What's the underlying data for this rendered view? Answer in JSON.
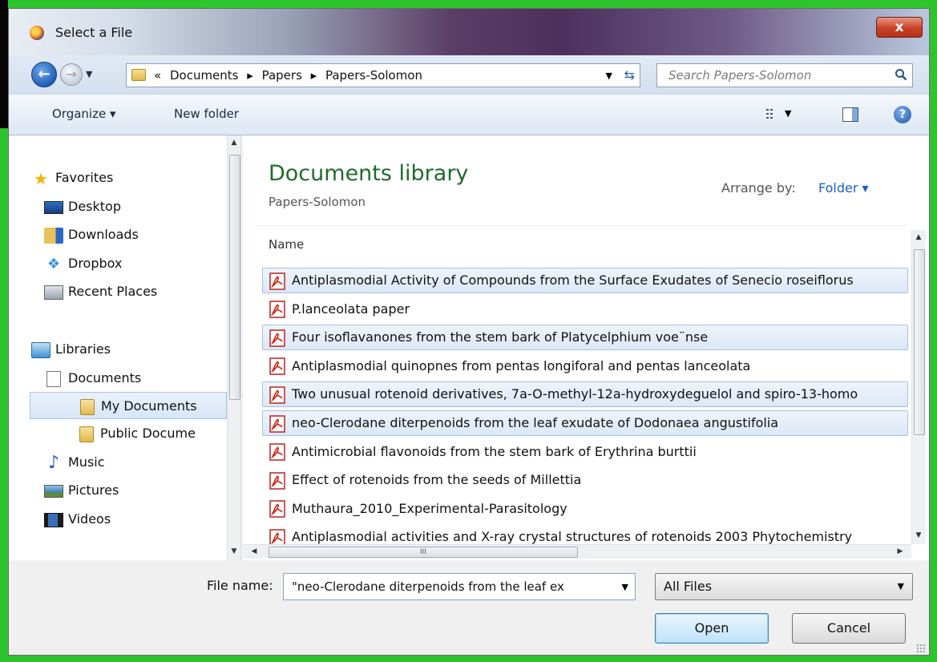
{
  "window": {
    "title": "Select a File",
    "close_label": "x"
  },
  "address": {
    "overflow": "«",
    "crumbs": [
      "Documents",
      "▸",
      "Papers",
      "▸",
      "Papers-Solomon"
    ],
    "search_placeholder": "Search Papers-Solomon"
  },
  "toolbar": {
    "organize": "Organize ▾",
    "new_folder": "New folder"
  },
  "nav": {
    "favorites": "Favorites",
    "desktop": "Desktop",
    "downloads": "Downloads",
    "dropbox": "Dropbox",
    "recent": "Recent Places",
    "libraries": "Libraries",
    "documents": "Documents",
    "my_documents": "My Documents",
    "public_documents": "Public Docume",
    "music": "Music",
    "pictures": "Pictures",
    "videos": "Videos"
  },
  "content": {
    "library_title": "Documents library",
    "library_sub": "Papers-Solomon",
    "arrange_label": "Arrange by:",
    "arrange_value": "Folder ▾",
    "column_name": "Name",
    "files": [
      {
        "name": "Antiplasmodial Activity of Compounds from the Surface Exudates of Senecio roseiflorus",
        "selected": true
      },
      {
        "name": "P.lanceolata paper",
        "selected": false
      },
      {
        "name": "Four isoflavanones from the stem bark of Platycelphium voe¨nse",
        "selected": true
      },
      {
        "name": "Antiplasmodial  quinopnes from pentas longiforal and pentas lanceolata",
        "selected": false
      },
      {
        "name": "Two unusual rotenoid derivatives, 7a-O-methyl-12a-hydroxydeguelol and spiro-13-homo",
        "selected": true
      },
      {
        "name": "neo-Clerodane diterpenoids from the leaf exudate of Dodonaea angustifolia",
        "selected": true
      },
      {
        "name": "Antimicrobial flavonoids from the stem bark of Erythrina burttii",
        "selected": false
      },
      {
        "name": "Effect of rotenoids from the seeds of Millettia",
        "selected": false
      },
      {
        "name": "Muthaura_2010_Experimental-Parasitology",
        "selected": false
      },
      {
        "name": "Antiplasmodial activities and X-ray crystal structures of rotenoids 2003 Phytochemistry",
        "selected": false
      }
    ],
    "hscroll_grip": "III"
  },
  "bottom": {
    "filename_label": "File name:",
    "filename_value": "\"neo-Clerodane diterpenoids from the leaf ex",
    "filter_value": "All Files",
    "open_label": "Open",
    "cancel_label": "Cancel"
  }
}
